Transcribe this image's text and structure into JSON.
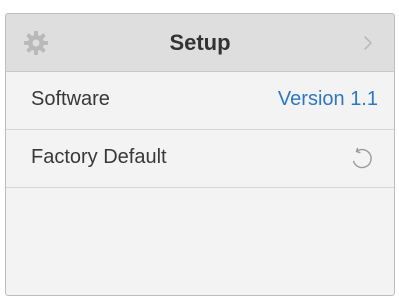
{
  "header": {
    "title": "Setup",
    "left_icon": "gear-icon",
    "right_icon": "chevron-right-icon"
  },
  "rows": [
    {
      "label": "Software",
      "value": "Version 1.1"
    },
    {
      "label": "Factory Default",
      "icon": "reset-icon"
    }
  ],
  "colors": {
    "header_bg": "#dedede",
    "panel_bg": "#f3f3f3",
    "value_link": "#2d78c4"
  }
}
